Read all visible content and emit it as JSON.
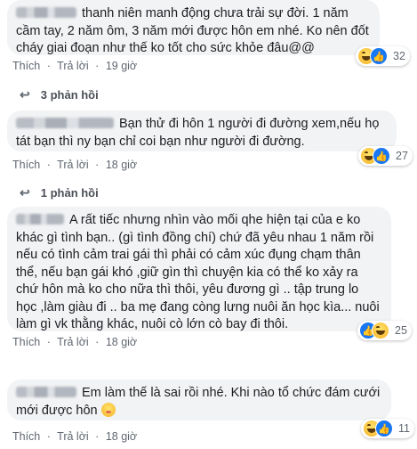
{
  "comments": [
    {
      "text": "thanh niên manh động chưa trải sự đời. 1 năm cầm tay, 2 năm ôm, 3 năm mới được hôn em nhé. Ko nên đốt cháy giai đoạn như thế ko tốt cho sức khỏe đâu@@",
      "like_label": "Thích",
      "reply_label": "Trả lời",
      "time": "19 giờ",
      "reaction_count": "32",
      "replies_label": "3 phản hồi"
    },
    {
      "text": "Bạn thử đi hôn 1 người đi đường xem,nếu họ tát bạn thì ny bạn chỉ coi bạn như người đi đường.",
      "like_label": "Thích",
      "reply_label": "Trả lời",
      "time": "18 giờ",
      "reaction_count": "27",
      "replies_label": "1 phản hồi"
    },
    {
      "text": "A rất tiếc nhưng nhìn vào mối qhe hiện tại của e ko khác gì tình bạn.. (gì tình đồng chí) chứ đã yêu nhau 1 năm rồi nếu có tình cảm trai gái thì phải có cảm xúc đụng chạm thân thể, nếu bạn gái khó ,giữ gìn thì chuyện kia có thể ko xảy ra chứ hôn mà ko cho nữa thì thôi, yêu đương gì .. tập trung lo học ,làm giàu đi .. ba mẹ đang còng lưng nuôi ăn học kìa... nuôi làm gì vk thằng khác, nuôi cò lớn cò bay đi thôi.",
      "like_label": "Thích",
      "reply_label": "Trả lời",
      "time": "18 giờ",
      "reaction_count": "25"
    },
    {
      "text": "Em làm thế là sai rồi nhé. Khi nào tổ chức đám cưới mới được hôn",
      "like_label": "Thích",
      "reply_label": "Trả lời",
      "time": "18 giờ",
      "reaction_count": "11"
    }
  ],
  "separator": "·",
  "reply_arrow": "↩",
  "icons": {
    "haha": "haha-reaction-icon",
    "like": "like-reaction-icon",
    "flushed": "flushed-face-emoji"
  },
  "colors": {
    "bubble": "#f2f3f5",
    "like_blue": "#1877f2",
    "meta": "#606770"
  }
}
